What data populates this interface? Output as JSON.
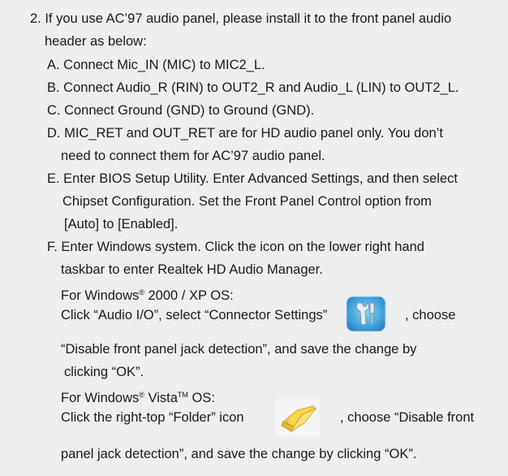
{
  "doc": {
    "item2_line1": "2. If you use AC’97 audio panel, please install it to the front panel audio",
    "item2_line2": "header as below:",
    "a": "A. Connect Mic_IN (MIC) to MIC2_L.",
    "b": "B. Connect Audio_R (RIN) to OUT2_R and Audio_L (LIN) to OUT2_L.",
    "c": "C. Connect Ground (GND) to Ground (GND).",
    "d_line1": "D. MIC_RET and OUT_RET are for HD audio panel only. You don’t",
    "d_line2": "need to connect them for AC’97 audio panel.",
    "e_line1": "E. Enter BIOS Setup Utility. Enter Advanced Settings, and then select",
    "e_line2": "Chipset Configuration. Set the Front Panel Control option from",
    "e_line3": "[Auto] to [Enabled].",
    "f_line1": "F. Enter Windows system. Click the icon on the lower right hand",
    "f_line2": "taskbar to enter Realtek HD Audio Manager.",
    "win2000_prefix": "For Windows",
    "win2000_reg": "®",
    "win2000_suffix": " 2000 / XP OS:",
    "xp_line1_part1": "Click “Audio I/O”, select “Connector Settings”",
    "xp_line1_part2": ", choose",
    "xp_line2": "“Disable front panel jack detection”, and save the change by",
    "xp_line3": "clicking “OK”.",
    "vista_prefix": "For Windows",
    "vista_reg": "®",
    "vista_mid": " Vista",
    "vista_tm": "TM",
    "vista_suffix": " OS:",
    "vista_line1_part1": "Click the right-top “Folder” icon",
    "vista_line1_part2": ", choose “Disable front",
    "vista_line2": "panel jack detection”, and save the change by clicking “OK”."
  },
  "icons": {
    "connector_settings": "wrench-tool-icon",
    "folder": "folder-icon"
  }
}
